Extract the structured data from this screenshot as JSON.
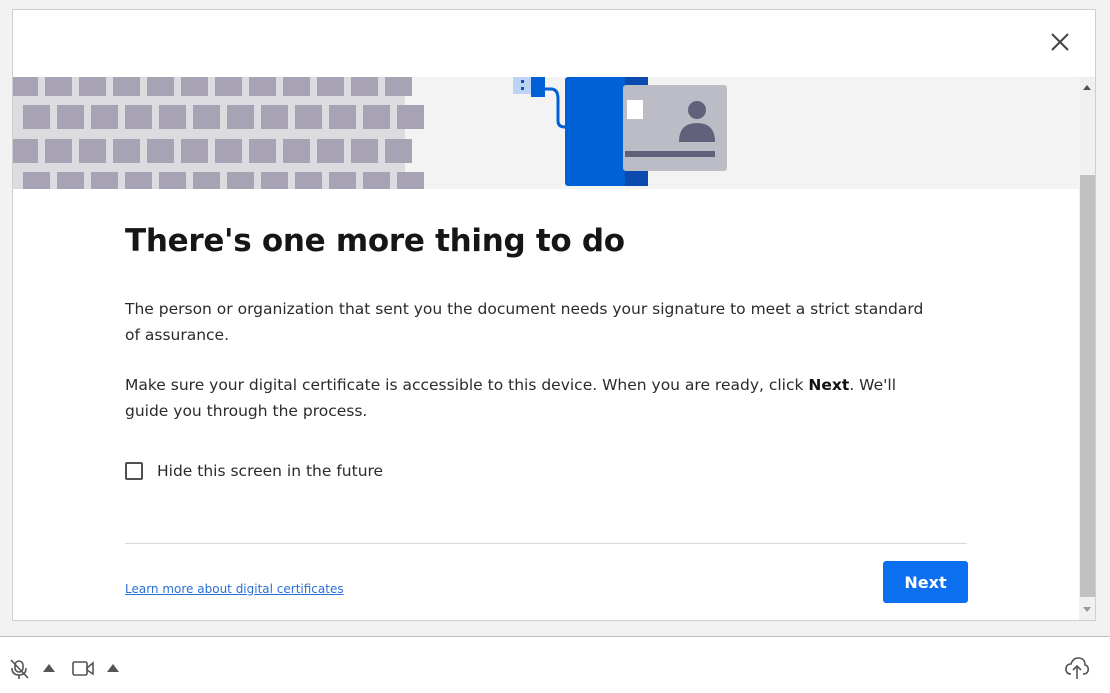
{
  "dialog": {
    "title": "There's one more thing to do",
    "paragraph1": "The person or organization that sent you the document needs your signature to meet a strict standard of assurance.",
    "paragraph2_before": "Make sure your digital certificate is accessible to this device. When you are ready, click ",
    "paragraph2_bold": "Next",
    "paragraph2_after": ". We'll guide you through the process.",
    "checkbox": {
      "label": "Hide this screen in the future",
      "checked": false
    },
    "learn_more_link": "Learn more about digital certificates",
    "next_button": "Next",
    "close_icon": "close-icon"
  },
  "toolbar": {
    "icons": [
      "microphone-muted-icon",
      "caret-up-icon",
      "video-camera-icon",
      "caret-up-icon",
      "cloud-upload-icon"
    ]
  },
  "colors": {
    "accent": "#0b6ff0",
    "card_blue": "#0060d6",
    "keyboard_key": "#a7a3b4",
    "link": "#2a6fd6"
  }
}
